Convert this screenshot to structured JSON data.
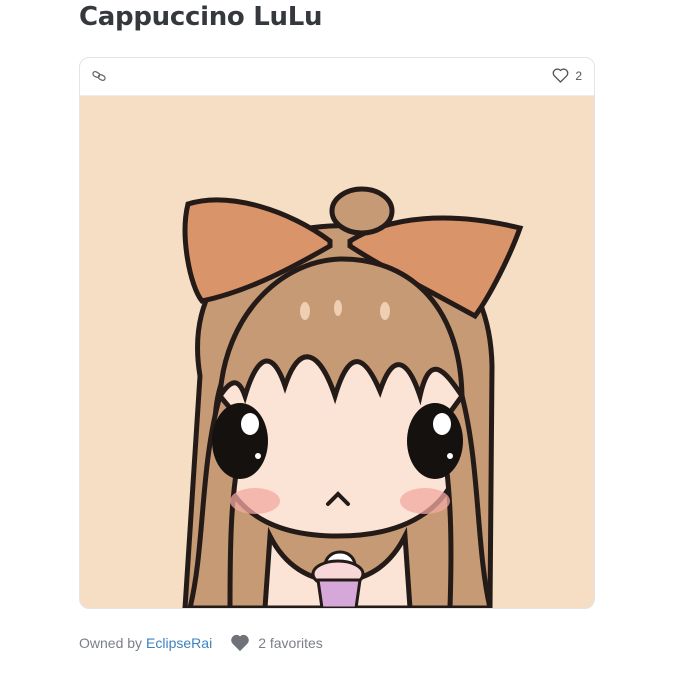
{
  "page": {
    "title": "Cappuccino LuLu"
  },
  "card": {
    "favorite_count": "2",
    "artwork_background": "#f5dec3"
  },
  "footer": {
    "owned_by_label": "Owned by",
    "owner_name": "EclipseRai",
    "favorites_text": "2 favorites"
  },
  "icons": {
    "link": "link-icon",
    "heart_outline": "heart-outline-icon",
    "heart_filled": "heart-filled-icon"
  }
}
